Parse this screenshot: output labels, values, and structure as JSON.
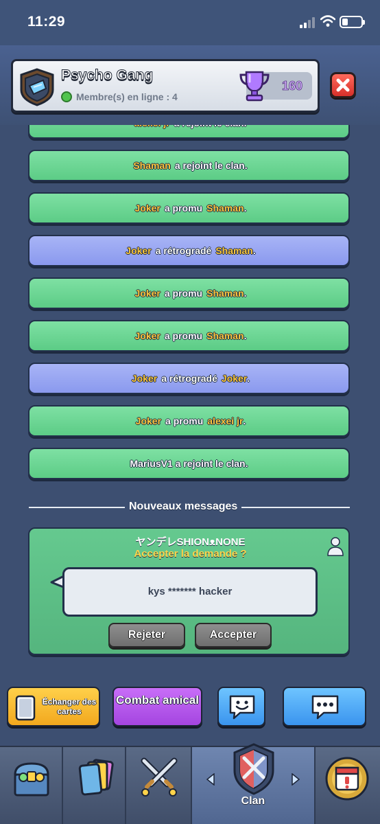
{
  "status_bar": {
    "time": "11:29"
  },
  "clan": {
    "name": "Psycho Gang",
    "online_label": "Membre(s) en ligne",
    "online_separator": " : ",
    "online_count": "4",
    "trophies": "160"
  },
  "feed": [
    {
      "style": "green",
      "parts": [
        [
          "name",
          "alexei jr"
        ],
        [
          "text",
          "a rejoint le clan."
        ]
      ]
    },
    {
      "style": "green",
      "parts": [
        [
          "name",
          "Shaman"
        ],
        [
          "text",
          "a rejoint le clan."
        ]
      ]
    },
    {
      "style": "green",
      "parts": [
        [
          "name",
          "Joker"
        ],
        [
          "text",
          "a promu"
        ],
        [
          "name",
          "Shaman"
        ],
        [
          "text",
          "."
        ]
      ]
    },
    {
      "style": "blue",
      "parts": [
        [
          "name",
          "Joker"
        ],
        [
          "text",
          "a rétrogradé"
        ],
        [
          "name",
          "Shaman"
        ],
        [
          "text",
          "."
        ]
      ]
    },
    {
      "style": "green",
      "parts": [
        [
          "name",
          "Joker"
        ],
        [
          "text",
          "a promu"
        ],
        [
          "name",
          "Shaman"
        ],
        [
          "text",
          "."
        ]
      ]
    },
    {
      "style": "green",
      "parts": [
        [
          "name",
          "Joker"
        ],
        [
          "text",
          "a promu"
        ],
        [
          "name",
          "Shaman"
        ],
        [
          "text",
          "."
        ]
      ]
    },
    {
      "style": "blue",
      "parts": [
        [
          "name",
          "Joker"
        ],
        [
          "text",
          "a rétrogradé"
        ],
        [
          "name",
          "Joker"
        ],
        [
          "text",
          "."
        ]
      ]
    },
    {
      "style": "green",
      "parts": [
        [
          "name",
          "Joker"
        ],
        [
          "text",
          "a promu"
        ],
        [
          "name",
          "alexei jr"
        ],
        [
          "text",
          "."
        ]
      ]
    },
    {
      "style": "green",
      "parts": [
        [
          "text",
          "MariusV1 a rejoint le clan."
        ]
      ]
    }
  ],
  "divider": {
    "label": "Nouveaux messages"
  },
  "join_request": {
    "player_name": "ヤンデレSHIONᴥNONE",
    "question": "Accepter la demande ?",
    "message": "kys ******* hacker",
    "reject_label": "Rejeter",
    "accept_label": "Accepter"
  },
  "actions": {
    "trade_label": "Échanger des cartes",
    "battle_label": "Combat amical"
  },
  "tabs": {
    "active_label": "Clan"
  },
  "colors": {
    "feed_green": "#5ccc86",
    "feed_blue": "#8a99ee",
    "player_name": "#ffc83d",
    "background": "#3d4f71"
  }
}
